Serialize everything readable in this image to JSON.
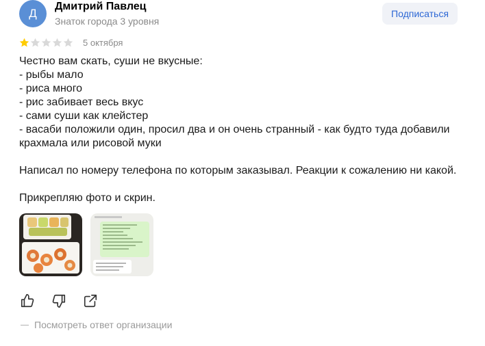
{
  "author": {
    "initial": "Д",
    "name": "Дмитрий Павлец",
    "badge": "Знаток города 3 уровня",
    "subscribe_label": "Подписаться"
  },
  "rating": {
    "value": 1,
    "max": 5,
    "date": "5 октября"
  },
  "review": {
    "lines": [
      "Честно вам скать, суши не вкусные:",
      "- рыбы мало",
      "- риса много",
      "- рис забивает весь вкус",
      "- сами суши как клейстер",
      "- васаби положили один, просил два и он очень странный - как будто туда добавили",
      "крахмала или рисовой муки",
      "",
      "Написал по номеру телефона по которым заказывал. Реакции к сожалению ни какой.",
      "",
      "Прикрепляю фото и скрин."
    ]
  },
  "photos": [
    {
      "icon": "sushi-photo"
    },
    {
      "icon": "chat-screenshot-photo"
    }
  ],
  "actions": [
    {
      "icon": "like-icon"
    },
    {
      "icon": "dislike-icon"
    },
    {
      "icon": "share-icon"
    }
  ],
  "org_reply_label": "Посмотреть ответ организации",
  "colors": {
    "avatar": "#5a8fd6",
    "star_filled": "#fc0",
    "star_empty": "#d9d9d9",
    "link": "#2c67d5"
  }
}
